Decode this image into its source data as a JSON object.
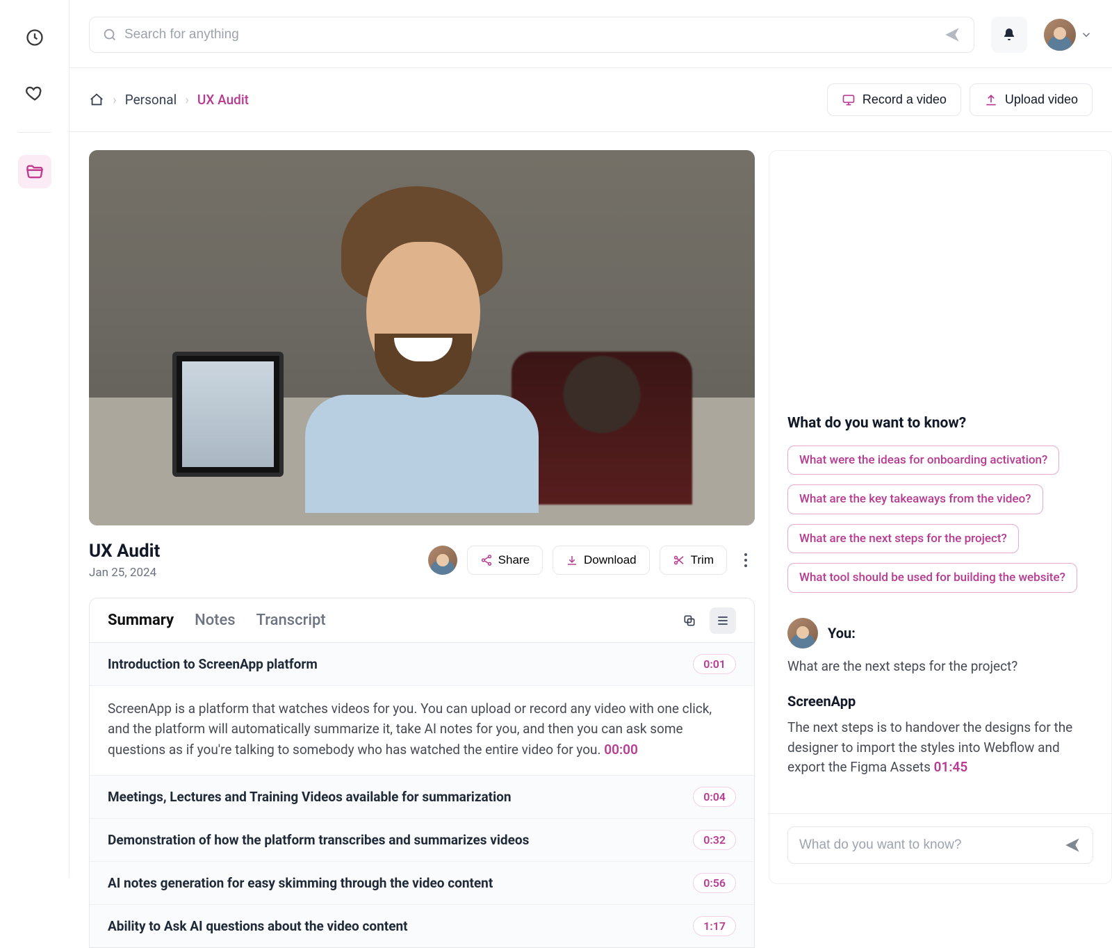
{
  "search": {
    "placeholder": "Search for anything"
  },
  "breadcrumb": {
    "personal": "Personal",
    "current": "UX Audit"
  },
  "header_buttons": {
    "record": "Record a video",
    "upload": "Upload video"
  },
  "video": {
    "title": "UX Audit",
    "date": "Jan 25, 2024",
    "share": "Share",
    "download": "Download",
    "trim": "Trim"
  },
  "tabs": {
    "summary": "Summary",
    "notes": "Notes",
    "transcript": "Transcript"
  },
  "chapters": [
    {
      "title": "Introduction to ScreenApp platform",
      "ts": "0:01",
      "body_prefix": "ScreenApp is a platform that watches videos for you. You can upload or record any video with one click, and the platform will automatically summarize it, take AI notes for you, and then you can ask some questions as if you're talking to somebody who has watched the entire video for you. ",
      "body_ts": "00:00"
    },
    {
      "title": "Meetings, Lectures and Training Videos available for summarization",
      "ts": "0:04"
    },
    {
      "title": "Demonstration of how the platform transcribes and summarizes videos",
      "ts": "0:32"
    },
    {
      "title": "AI notes generation for easy skimming through the video content",
      "ts": "0:56"
    },
    {
      "title": "Ability to Ask AI questions about the video content",
      "ts": "1:17"
    }
  ],
  "chat": {
    "heading": "What do you want to know?",
    "suggestions": [
      "What were the ideas for onboarding activation?",
      "What are the key takeaways from the video?",
      "What are the next steps for the project?",
      "What tool should be used for building the website?"
    ],
    "you_label": "You:",
    "you_message": "What are the next steps for the project?",
    "bot_name": "ScreenApp",
    "bot_message_prefix": "The next steps is to handover the designs for the designer to import the styles into Webflow and export the Figma Assets ",
    "bot_ts": "01:45",
    "input_placeholder": "What do you want to know?"
  }
}
